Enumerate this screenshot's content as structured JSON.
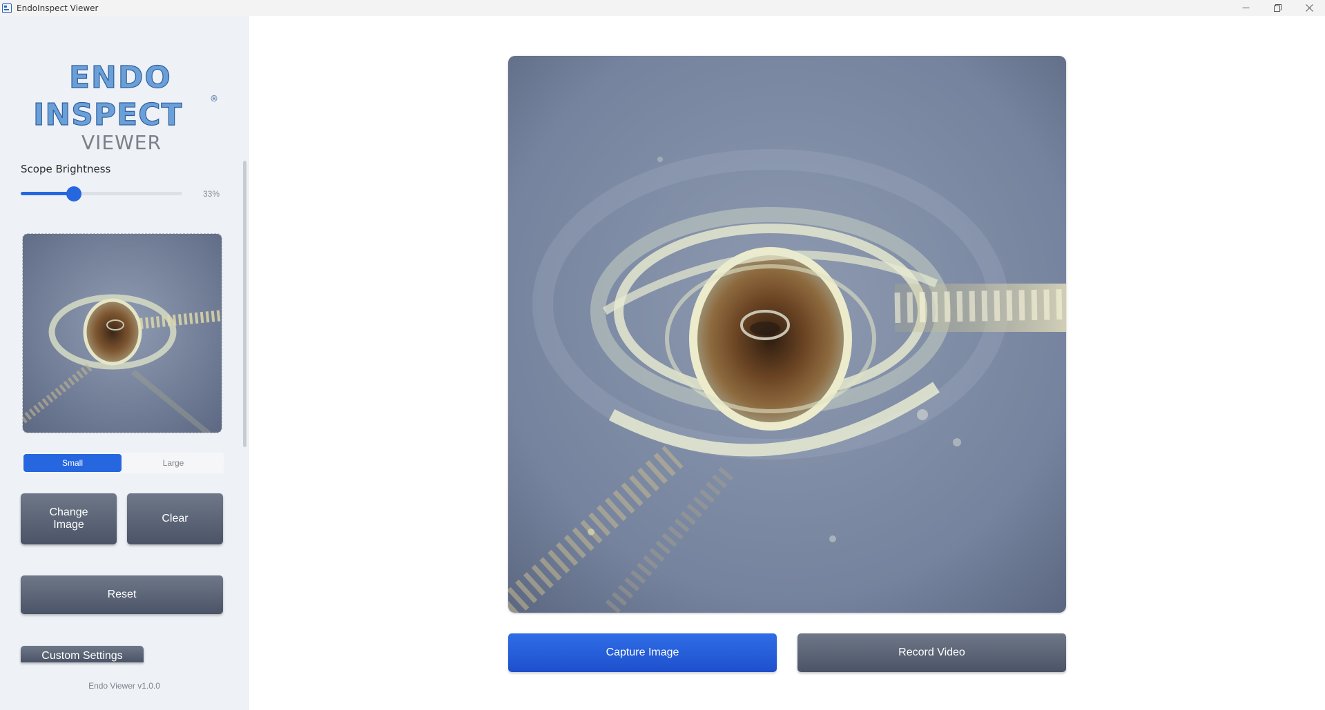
{
  "window": {
    "title": "EndoInspect Viewer"
  },
  "logo": {
    "line1": "ENDO",
    "line2": "INSPECT",
    "registered": "®",
    "line3": "VIEWER"
  },
  "brightness": {
    "label": "Scope Brightness",
    "value": 33,
    "value_text": "33%"
  },
  "size_toggle": {
    "options": [
      "Small",
      "Large"
    ],
    "selected": "Small"
  },
  "buttons": {
    "change_image": "Change Image",
    "clear": "Clear",
    "reset": "Reset",
    "custom_settings": "Custom Settings",
    "capture_image": "Capture Image",
    "record_video": "Record Video"
  },
  "version": "Endo Viewer v1.0.0",
  "colors": {
    "accent": "#2667e0",
    "button_gray": "#5a6376",
    "sidebar_bg": "#eef1f6"
  }
}
